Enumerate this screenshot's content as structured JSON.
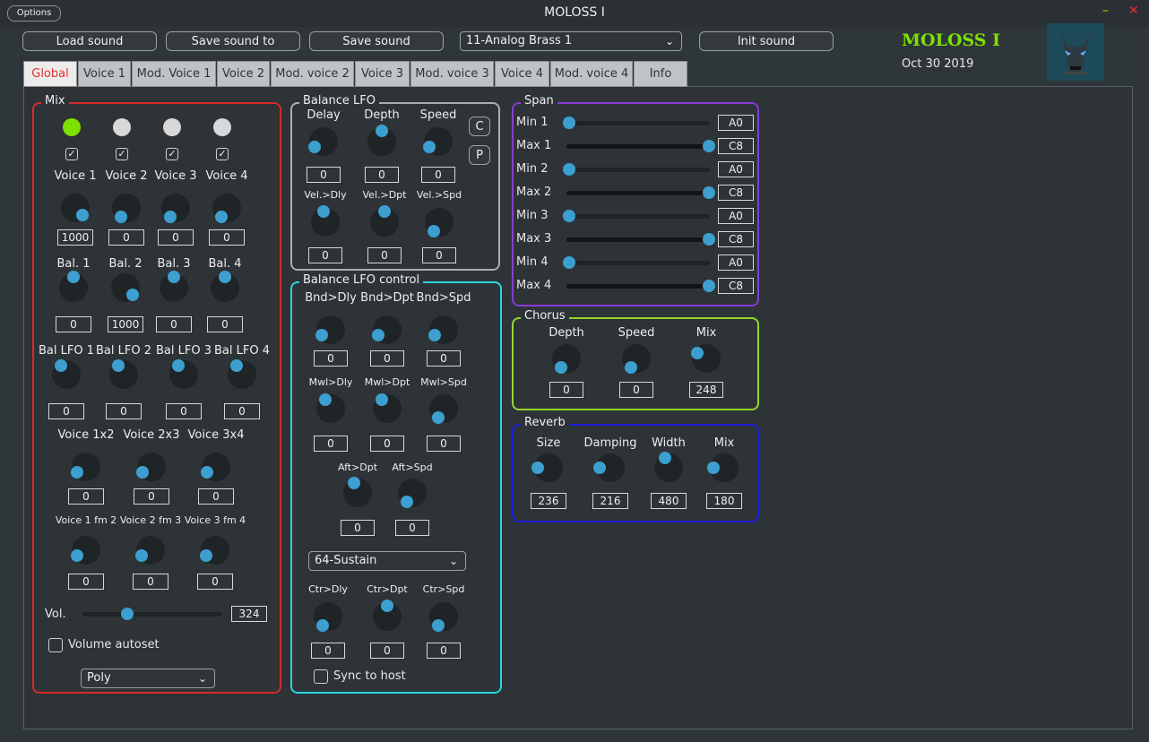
{
  "window": {
    "title": "MOLOSS I",
    "options_label": "Options",
    "minimize": "–",
    "close": "✕"
  },
  "toolbar": {
    "load": "Load sound",
    "save_to": "Save sound to",
    "save": "Save sound",
    "preset": "11-Analog Brass 1",
    "init": "Init sound"
  },
  "brand": {
    "name": "MOLOSS I",
    "date": "Oct 30 2019",
    "name_color": "#7ee000"
  },
  "tabs": [
    "Global",
    "Voice 1",
    "Mod. Voice 1",
    "Voice 2",
    "Mod. voice 2",
    "Voice 3",
    "Mod. voice 3",
    "Voice 4",
    "Mod. voice 4",
    "Info"
  ],
  "mix": {
    "title": "Mix",
    "leds": [
      {
        "on": true
      },
      {
        "on": false
      },
      {
        "on": false
      },
      {
        "on": false
      }
    ],
    "checks": [
      "✓",
      "✓",
      "✓",
      "✓"
    ],
    "voice_labels": [
      "Voice 1",
      "Voice 2",
      "Voice 3",
      "Voice 4"
    ],
    "voice_values": [
      "1000",
      "0",
      "0",
      "0"
    ],
    "bal_labels": [
      "Bal. 1",
      "Bal. 2",
      "Bal. 3",
      "Bal. 4"
    ],
    "bal_values": [
      "0",
      "1000",
      "0",
      "0"
    ],
    "ballfo_labels": [
      "Bal LFO 1",
      "Bal LFO 2",
      "Bal LFO 3",
      "Bal LFO 4"
    ],
    "ballfo_values": [
      "0",
      "0",
      "0",
      "0"
    ],
    "cross_labels": [
      "Voice 1x2",
      "Voice 2x3",
      "Voice 3x4"
    ],
    "cross_values": [
      "0",
      "0",
      "0"
    ],
    "fm_labels": [
      "Voice 1 fm 2",
      "Voice 2 fm 3",
      "Voice 3 fm 4"
    ],
    "fm_values": [
      "0",
      "0",
      "0"
    ],
    "vol_label": "Vol.",
    "vol_value": "324",
    "vol_level": 0.32,
    "autoset_label": "Volume autoset",
    "mode": "Poly"
  },
  "balance_lfo": {
    "title": "Balance LFO",
    "labels": [
      "Delay",
      "Depth",
      "Speed"
    ],
    "values": [
      "0",
      "0",
      "0"
    ],
    "vel_labels": [
      "Vel.>Dly",
      "Vel.>Dpt",
      "Vel.>Spd"
    ],
    "vel_values": [
      "0",
      "0",
      "0"
    ],
    "btn_c": "C",
    "btn_p": "P"
  },
  "lfo_control": {
    "title": "Balance LFO control",
    "bnd_labels": [
      "Bnd>Dly",
      "Bnd>Dpt",
      "Bnd>Spd"
    ],
    "bnd_values": [
      "0",
      "0",
      "0"
    ],
    "mwl_labels": [
      "Mwl>Dly",
      "Mwl>Dpt",
      "Mwl>Spd"
    ],
    "mwl_values": [
      "0",
      "0",
      "0"
    ],
    "aft_labels": [
      "Aft>Dpt",
      "Aft>Spd"
    ],
    "aft_values": [
      "0",
      "0"
    ],
    "controller": "64-Sustain",
    "ctr_labels": [
      "Ctr>Dly",
      "Ctr>Dpt",
      "Ctr>Spd"
    ],
    "ctr_values": [
      "0",
      "0",
      "0"
    ],
    "sync_label": "Sync to host"
  },
  "span": {
    "title": "Span",
    "rows": [
      {
        "label": "Min 1",
        "value": "A0",
        "level": 0
      },
      {
        "label": "Max 1",
        "value": "C8",
        "level": 1
      },
      {
        "label": "Min 2",
        "value": "A0",
        "level": 0
      },
      {
        "label": "Max 2",
        "value": "C8",
        "level": 1
      },
      {
        "label": "Min 3",
        "value": "A0",
        "level": 0
      },
      {
        "label": "Max 3",
        "value": "C8",
        "level": 1
      },
      {
        "label": "Min 4",
        "value": "A0",
        "level": 0
      },
      {
        "label": "Max 4",
        "value": "C8",
        "level": 1
      }
    ]
  },
  "chorus": {
    "title": "Chorus",
    "labels": [
      "Depth",
      "Speed",
      "Mix"
    ],
    "values": [
      "0",
      "0",
      "248"
    ]
  },
  "reverb": {
    "title": "Reverb",
    "labels": [
      "Size",
      "Damping",
      "Width",
      "Mix"
    ],
    "values": [
      "236",
      "216",
      "480",
      "180"
    ]
  },
  "colors": {
    "mix": "#d62a2a",
    "lfo": "#a8aeb2",
    "lfo_ctrl": "#2ad6e0",
    "span": "#8a3ad6",
    "chorus": "#96d62a",
    "reverb": "#1a1ad6",
    "knob_dot": "#3c9fd0",
    "led_on": "#7ee000",
    "led_off": "#d8d8d8"
  }
}
